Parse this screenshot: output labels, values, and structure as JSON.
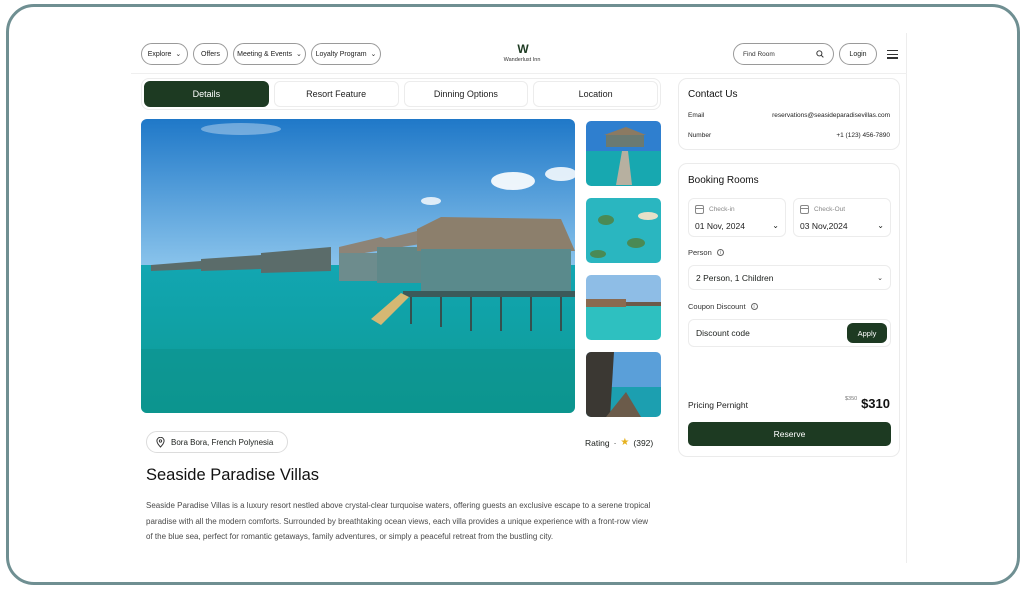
{
  "header": {
    "nav": [
      {
        "label": "Explore",
        "has_dropdown": true
      },
      {
        "label": "Offers",
        "has_dropdown": false
      },
      {
        "label": "Meeting & Events",
        "has_dropdown": true
      },
      {
        "label": "Loyalty Program",
        "has_dropdown": true
      }
    ],
    "logo_mark": "W",
    "logo_text": "Wanderlust Inn",
    "search_placeholder": "Find Room",
    "login_label": "Login"
  },
  "tabs": [
    {
      "label": "Details",
      "active": true
    },
    {
      "label": "Resort Feature",
      "active": false
    },
    {
      "label": "Dinning Options",
      "active": false
    },
    {
      "label": "Location",
      "active": false
    }
  ],
  "property": {
    "location": "Bora Bora, French Polynesia",
    "rating_label": "Rating",
    "rating_separator": "·",
    "rating_count": "(392)",
    "title": "Seaside Paradise Villas",
    "description": "Seaside Paradise Villas is a luxury resort nestled above crystal-clear turquoise waters, offering guests an exclusive escape to a serene tropical paradise with all the modern comforts. Surrounded by breathtaking ocean views, each villa provides a unique experience with a front-row view of the blue sea, perfect for romantic getaways, family adventures, or simply a peaceful retreat from the bustling city."
  },
  "contact": {
    "title": "Contact Us",
    "email_label": "Email",
    "email_value": "reservations@seasideparadisevillas.com",
    "number_label": "Number",
    "number_value": "+1 (123) 456-7890"
  },
  "booking": {
    "title": "Booking Rooms",
    "checkin_label": "Check-in",
    "checkin_value": "01 Nov, 2024",
    "checkout_label": "Check-Out",
    "checkout_value": "03 Nov,2024",
    "person_label": "Person",
    "person_value": "2 Person, 1 Children",
    "coupon_label": "Coupon Discount",
    "coupon_placeholder": "Discount code",
    "apply_label": "Apply",
    "pricing_label": "Pricing Pernight",
    "old_price": "$350",
    "new_price": "$310",
    "reserve_label": "Reserve"
  },
  "colors": {
    "primary": "#1d3a22",
    "frame": "#6f8f92",
    "star": "#e6b11e"
  },
  "icons": [
    "chevron-down-icon",
    "search-icon",
    "menu-icon",
    "location-pin-icon",
    "star-icon",
    "calendar-icon",
    "info-icon"
  ]
}
